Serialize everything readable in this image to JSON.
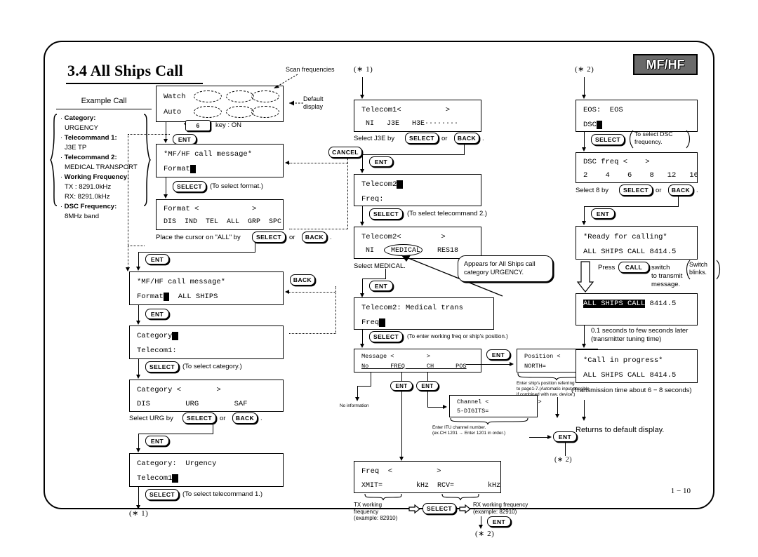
{
  "document": {
    "section_title": "3.4 All Ships Call",
    "badge": "MF/HF",
    "page_number": "1 − 10"
  },
  "example_call": {
    "heading": "Example Call",
    "items": [
      {
        "label": "Category:",
        "value": "URGENCY"
      },
      {
        "label": "Telecommand 1:",
        "value": "J3E TP"
      },
      {
        "label": "Telecommand 2:",
        "value": "MEDICAL TRANSPORT"
      },
      {
        "label": "Working Frequency:",
        "value": "TX : 8291.0kHz"
      },
      {
        "label": "",
        "value": "RX: 8291.0kHz"
      },
      {
        "label": "DSC Frequency:",
        "value": "8MHz band"
      }
    ]
  },
  "keys": {
    "ent": "ENT",
    "select": "SELECT",
    "back": "BACK",
    "cancel": "CANCEL",
    "call": "CALL",
    "six": "6"
  },
  "column1": {
    "default_display": {
      "line1": "Watch",
      "line2": "Auto",
      "annotation_scan": "Scan frequencies",
      "annotation_default": "Default\ndisplay"
    },
    "key_on_note": "key : ON",
    "screens": [
      {
        "name": "mfhf-call-message-format",
        "line1": "*MF/HF call message*",
        "line2": "Format",
        "cursor": true
      },
      {
        "name": "format-select",
        "line1": "Format <            >",
        "line2": "DIS  IND  TEL  ALL  GRP  SPC"
      },
      {
        "name": "mfhf-call-message-all-ships",
        "line1": "*MF/HF call message*",
        "line2": "Format",
        "line2b": "  ALL SHIPS",
        "cursor": true
      },
      {
        "name": "category-telecom1",
        "line1": "Category",
        "line1b": "",
        "line2": "Telecom1:",
        "cursor": true
      },
      {
        "name": "category-select",
        "line1": "Category <        >",
        "line2": "DIS        URG        SAF"
      },
      {
        "name": "category-urgency",
        "line1": "Category:  Urgency",
        "line2": "Telecom1",
        "cursor": true
      }
    ],
    "notes": {
      "select_format": "(To select format.)",
      "place_cursor_all": "Place the cursor on \"ALL\" by",
      "place_cursor_all_or": "or",
      "place_cursor_all_end": ".",
      "select_category": "(To select category.)",
      "select_urg": "Select URG by",
      "select_urg_or": "or",
      "select_urg_end": ".",
      "select_telecommand1": "(To select telecommand 1.)"
    },
    "ref_out": "(∗ 1)"
  },
  "column2": {
    "ref_in": "(∗ 1)",
    "screens": [
      {
        "name": "telecom1-select",
        "line1": "Telecom1<          >",
        "line2": " NI   J3E   H3E········"
      },
      {
        "name": "telecom2-freq",
        "line1": "Telecom2",
        "line2": "Freq:",
        "cursor": true
      },
      {
        "name": "telecom2-select",
        "line1": "Telecom2<         >",
        "line2": " NI    MEDICAL    RES18"
      },
      {
        "name": "telecom2-medical-trans",
        "line1": "Telecom2: Medical trans",
        "line2": "Freq",
        "cursor": true
      },
      {
        "name": "message-select",
        "line1": "Message <         >",
        "line2": "No      FREQ      CH      POS"
      },
      {
        "name": "position-entry",
        "line1": "Position <          >",
        "line2": "NORTH="
      },
      {
        "name": "channel-entry",
        "line1": "Channel <              >",
        "line2": "5-DIGITS="
      },
      {
        "name": "freq-entry",
        "line1": "Freq  <          >",
        "line2": "XMIT=        kHz  RCV=        kHz"
      }
    ],
    "notes": {
      "select_j3e": "Select J3E by",
      "select_j3e_or": "or",
      "select_j3e_end": ".",
      "select_telecommand2": "(To select telecommand 2.)",
      "select_medical": "Select MEDICAL.",
      "bubble": "Appears for All Ships call\ncategory URGENCY.",
      "enter_working": "(To enter working freq or ship's position.)",
      "no_information": "No information",
      "position_hint": "Enter ship's position referring\nto page1-7.(Automatic input possible\nif combined with nav. device.)",
      "channel_hint": "Enter ITU channel number.\n(ex.CH 1201 → Enter 1201 in order.)",
      "tx_freq": "TX working\nfrequency\n(example: 82910)",
      "rx_freq": "RX working frequency\n(example: 82910)"
    },
    "ref_out_a": "(∗ 2)",
    "ref_out_b": "(∗ 2)",
    "ref_out_c": "(∗ 2)"
  },
  "column3": {
    "ref_in": "(∗ 2)",
    "screens": [
      {
        "name": "eos-dsc",
        "line1": "EOS:  EOS",
        "line2": "DSC",
        "cursor": true
      },
      {
        "name": "dsc-freq-select",
        "line1": "DSC freq <    >",
        "line2": "2    4    6    8   12   16"
      },
      {
        "name": "ready-for-calling",
        "line1": "*Ready for calling*",
        "line2": "ALL SHIPS CALL 8414.5"
      },
      {
        "name": "transmitting",
        "line1_inv": "ALL SHIPS CALL",
        "line1_rest": " 8414.5",
        "line2": ""
      },
      {
        "name": "call-in-progress",
        "line1": "*Call in progress*",
        "line2": "ALL SHIPS CALL 8414.5"
      }
    ],
    "notes": {
      "select_dsc": "To select DSC\nfrequency.",
      "select_8": "Select 8 by",
      "select_8_or": "or",
      "select_8_end": ".",
      "press_call": "Press",
      "press_call_2": "switch\nto transmit message.",
      "switch_blinks": "Switch\nblinks.",
      "tuning_time": "0.1 seconds to few seconds later\n(transmitter tuning time)",
      "transmission_time": "(Transmission time about 6 − 8 seconds)",
      "returns_default": "Returns to default display."
    }
  }
}
